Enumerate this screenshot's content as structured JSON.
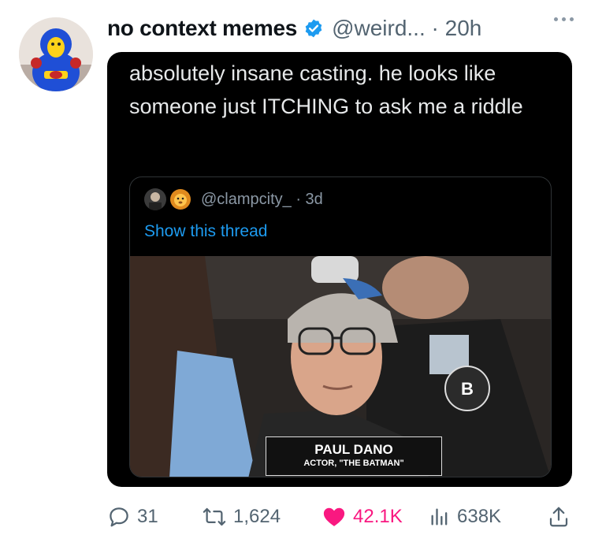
{
  "tweet": {
    "display_name": "no context memes",
    "handle_time": "@weird... · 20h",
    "text": "absolutely insane casting. he looks like someone just ITCHING to ask me a riddle"
  },
  "quote": {
    "handle_time": "@clampcity_ · 3d",
    "show_thread": "Show this thread",
    "caption_name": "PAUL DANO",
    "caption_role": "ACTOR, \"THE BATMAN\""
  },
  "actions": {
    "replies": "31",
    "retweets": "1,624",
    "likes": "42.1K",
    "views": "638K"
  },
  "colors": {
    "verified": "#1d9bf0",
    "like": "#f91880",
    "link": "#1d9bf0"
  },
  "icons": [
    "verified-badge-icon",
    "more-icon",
    "reply-icon",
    "retweet-icon",
    "heart-icon",
    "views-icon",
    "share-icon"
  ]
}
